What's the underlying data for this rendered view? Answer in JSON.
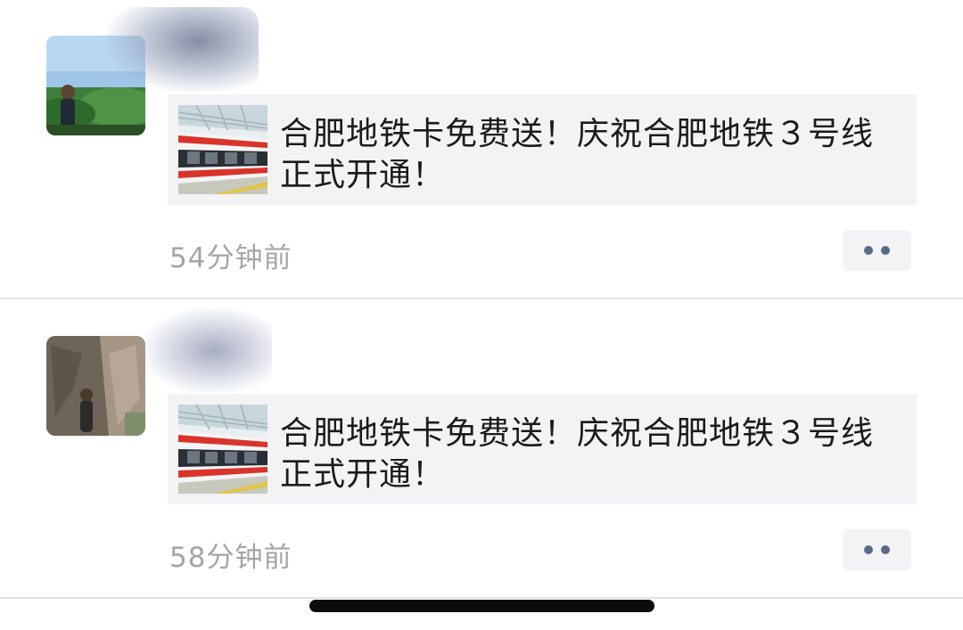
{
  "posts": [
    {
      "card_text": "合肥地铁卡免费送！庆祝合肥地铁３号线正式开通！",
      "time": "54分钟前",
      "avatar_icon": "user-avatar-outdoor-icon",
      "thumb_icon": "metro-train-icon"
    },
    {
      "card_text": "合肥地铁卡免费送！庆祝合肥地铁３号线正式开通！",
      "time": "58分钟前",
      "avatar_icon": "user-avatar-rock-icon",
      "thumb_icon": "metro-train-icon"
    }
  ],
  "colors": {
    "card_bg": "#f3f3f5",
    "time_text": "#a5a5a8",
    "more_dots": "#5d6a85",
    "divider": "#e3e3e3"
  }
}
